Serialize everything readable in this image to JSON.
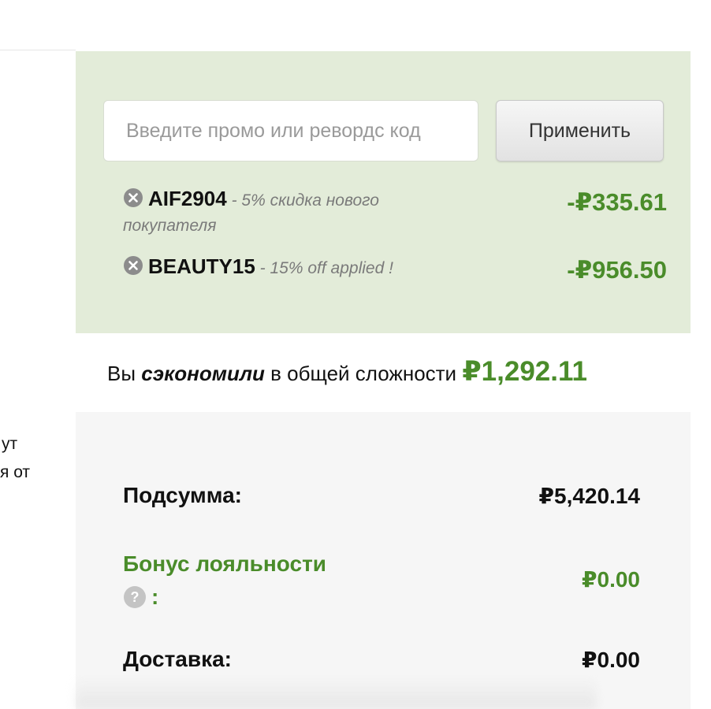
{
  "left_cutoff": {
    "line1": "ут",
    "line2": "я от"
  },
  "promo": {
    "input_placeholder": "Введите промо или ревордс код",
    "input_value": "",
    "apply_label": "Применить",
    "codes": [
      {
        "name": "AIF2904",
        "description": " - 5% скидка нового покупателя",
        "amount": "-₽335.61"
      },
      {
        "name": "BEAUTY15",
        "description": " - 15% off applied !",
        "amount": "-₽956.50"
      }
    ]
  },
  "savings": {
    "prefix": "Вы ",
    "emphasis": "сэкономили",
    "suffix": " в общей сложности ",
    "amount": "₽1,292.11"
  },
  "summary": {
    "subtotal_label": "Подсумма:",
    "subtotal_value": "₽5,420.14",
    "loyalty_label": "Бонус лояльности",
    "loyalty_colon": ":",
    "loyalty_value": "₽0.00",
    "delivery_label": "Доставка:",
    "delivery_value": "₽0.00"
  },
  "colors": {
    "promo_bg": "#e3ecd9",
    "summary_bg": "#f6f6f6",
    "accent_green": "#4a8c2a",
    "icon_gray": "#8c8c8c"
  },
  "icons": {
    "remove": "close-circle-icon",
    "help": "question-circle-icon"
  }
}
